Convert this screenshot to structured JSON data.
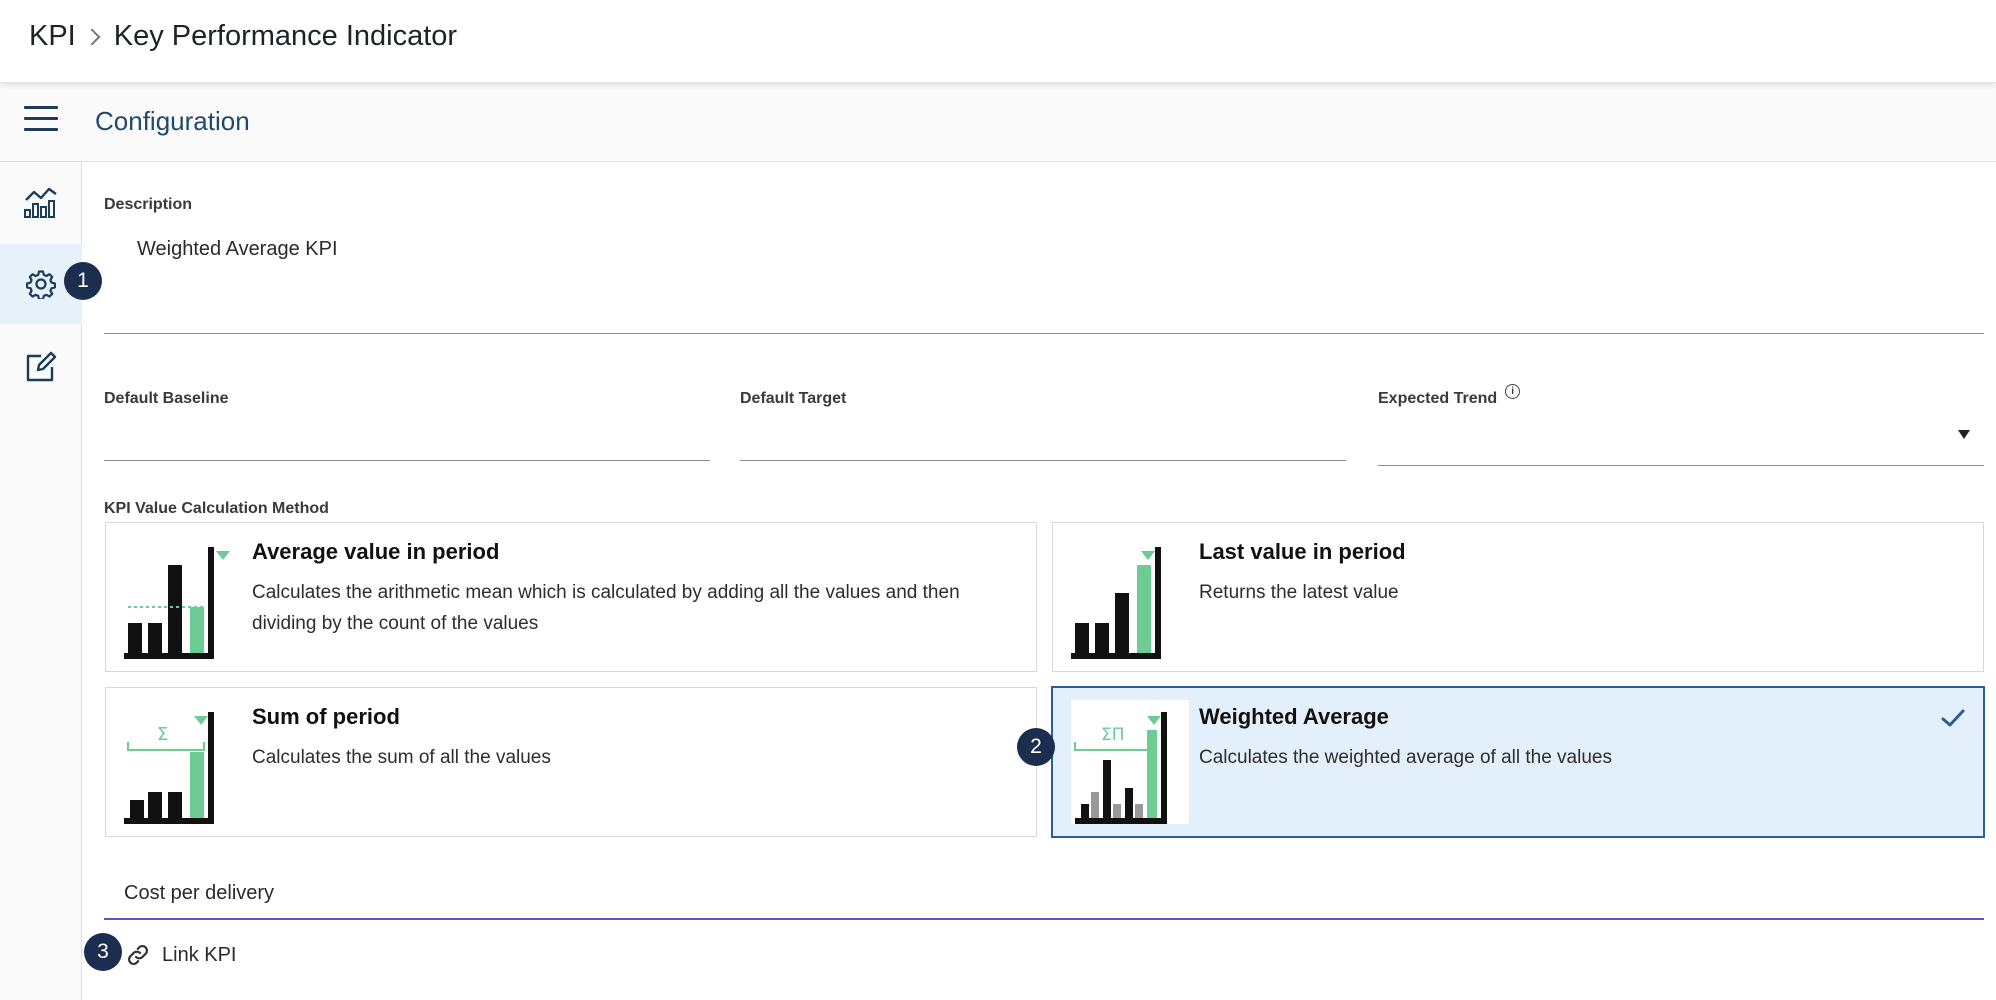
{
  "header": {
    "breadcrumb_root": "KPI",
    "breadcrumb_current": "Key Performance Indicator"
  },
  "subheader": {
    "title": "Configuration"
  },
  "sidebar": {
    "items": [
      {
        "icon": "chart-icon"
      },
      {
        "icon": "gear-icon",
        "active": true
      },
      {
        "icon": "edit-icon"
      }
    ]
  },
  "badges": [
    "1",
    "2",
    "3"
  ],
  "form": {
    "description_label": "Description",
    "description_value": "Weighted Average KPI",
    "baseline_label": "Default Baseline",
    "target_label": "Default Target",
    "trend_label": "Expected Trend",
    "calc_method_label": "KPI Value Calculation Method",
    "kpi_link_value": "Cost per delivery",
    "link_label": "Link KPI"
  },
  "methods": [
    {
      "title": "Average value in period",
      "description": "Calculates the arithmetic mean which is calculated by adding all the values and then dividing by the count of the values",
      "selected": false
    },
    {
      "title": "Last value in period",
      "description": "Returns the latest value",
      "selected": false
    },
    {
      "title": "Sum of period",
      "description": "Calculates the sum of all the values",
      "selected": false
    },
    {
      "title": "Weighted Average",
      "description": "Calculates the weighted average of all the values",
      "selected": true
    }
  ],
  "thumb_symbols": {
    "sum": "Σ",
    "weighted": "ΣΠ"
  },
  "colors": {
    "accent_green": "#6dcb94",
    "selected_bg": "#e3effb",
    "selected_border": "#2b5e96",
    "badge": "#1c2e4f"
  }
}
